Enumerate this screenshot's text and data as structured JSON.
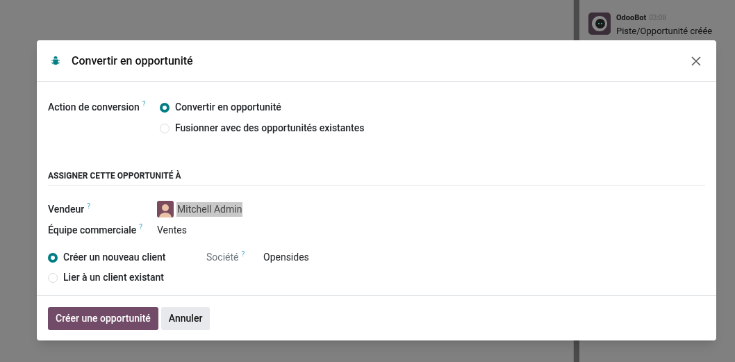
{
  "chatter": {
    "messages": [
      {
        "author": "OdooBot",
        "time": "03:08",
        "body": "Piste/Opportunité créée"
      }
    ]
  },
  "dialog": {
    "title": "Convertir en opportunité",
    "conversion": {
      "label": "Action de conversion",
      "help": "?",
      "options": [
        {
          "label": "Convertir en opportunité",
          "selected": true
        },
        {
          "label": "Fusionner avec des opportunités existantes",
          "selected": false
        }
      ]
    },
    "section_title": "ASSIGNER CETTE OPPORTUNITÉ À",
    "salesperson": {
      "label": "Vendeur",
      "help": "?",
      "value": "Mitchell Admin"
    },
    "team": {
      "label": "Équipe commerciale",
      "help": "?",
      "value": "Ventes"
    },
    "customer": {
      "options": [
        {
          "label": "Créer un nouveau client",
          "selected": true
        },
        {
          "label": "Lier à un client existant",
          "selected": false
        }
      ]
    },
    "company": {
      "label": "Société",
      "help": "?",
      "value": "Opensides"
    },
    "buttons": [
      {
        "label": "Créer une opportunité",
        "kind": "primary"
      },
      {
        "label": "Annuler",
        "kind": "secondary"
      }
    ]
  }
}
